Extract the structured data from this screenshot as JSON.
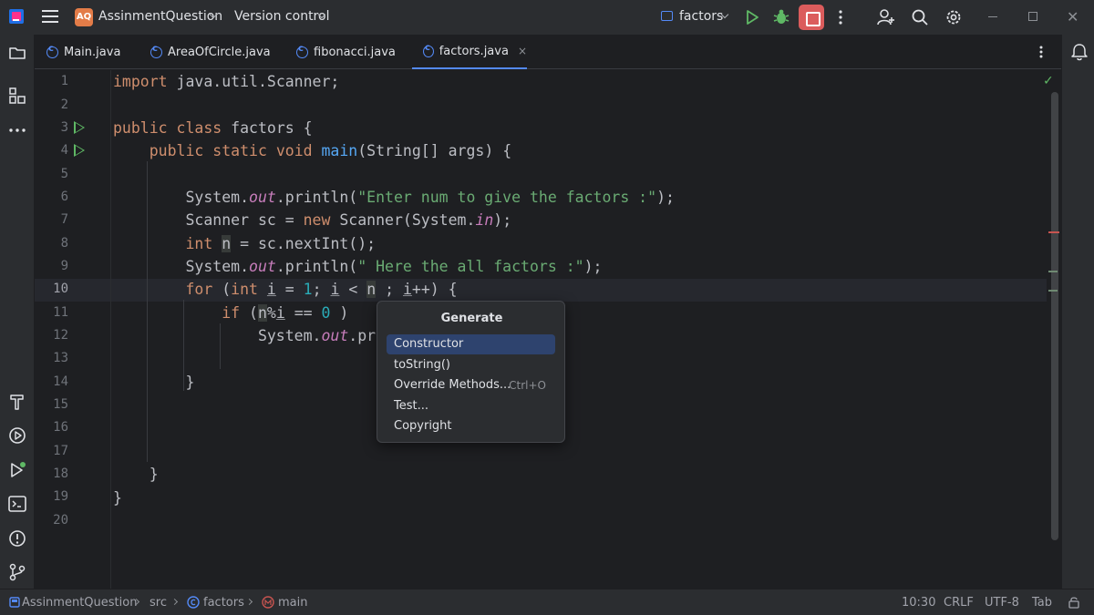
{
  "titlebar": {
    "project_badge": "AQ",
    "project_name": "AssinmentQuestion",
    "vcs_label": "Version control",
    "run_config": "factors"
  },
  "tabs": [
    {
      "label": "Main.java"
    },
    {
      "label": "AreaOfCircle.java"
    },
    {
      "label": "fibonacci.java"
    },
    {
      "label": "factors.java",
      "active": true,
      "close": "×"
    }
  ],
  "editor": {
    "line_numbers": [
      "1",
      "2",
      "3",
      "4",
      "5",
      "6",
      "7",
      "8",
      "9",
      "10",
      "11",
      "12",
      "13",
      "14",
      "15",
      "16",
      "17",
      "18",
      "19",
      "20"
    ],
    "current_line": "10",
    "run_gutter_lines": [
      "3",
      "4"
    ]
  },
  "popup": {
    "title": "Generate",
    "items": [
      {
        "label": "Constructor",
        "selected": true
      },
      {
        "label": "toString()"
      },
      {
        "label": "Override Methods...",
        "shortcut": "Ctrl+O"
      },
      {
        "label": "Test..."
      },
      {
        "label": "Copyright"
      }
    ]
  },
  "statusbar": {
    "crumbs": [
      "AssinmentQuestion",
      "src",
      "factors",
      "main"
    ],
    "position": "10:30",
    "line_separator": "CRLF",
    "encoding": "UTF-8",
    "indent": "Tab"
  },
  "colors": {
    "accent": "#548af7",
    "run_green": "#5fb865",
    "stop_red": "#db5c5c",
    "keyword": "#cf8e6d",
    "string": "#6aab73",
    "method": "#56a8f5"
  }
}
